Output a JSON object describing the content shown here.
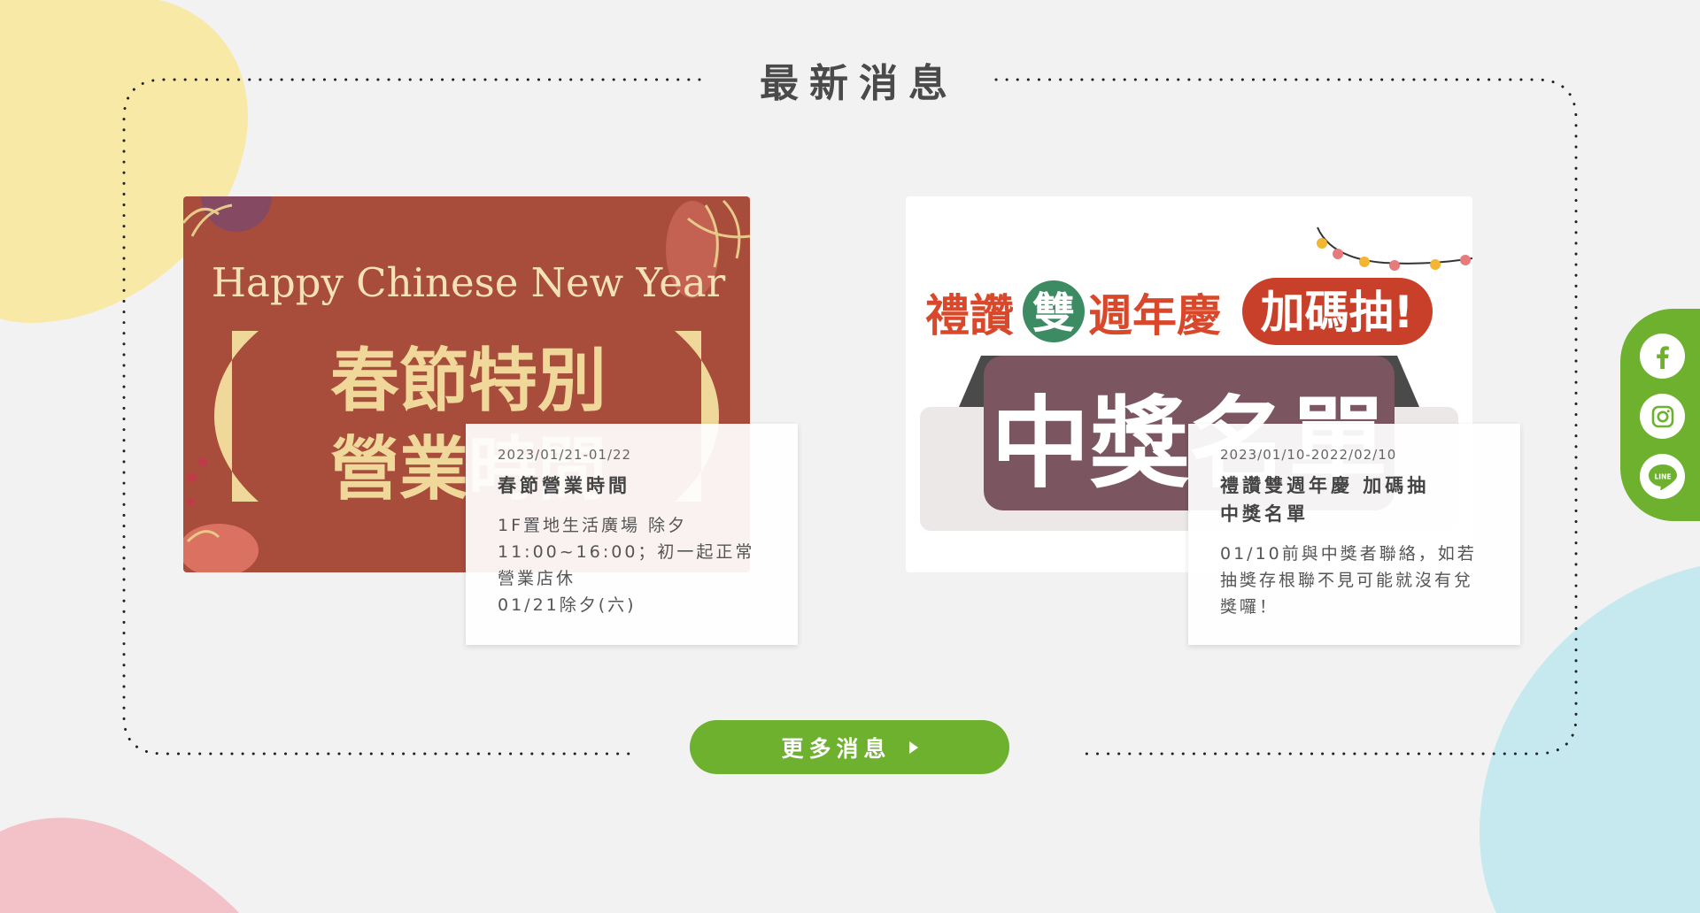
{
  "section": {
    "title": "最新消息"
  },
  "news": [
    {
      "date": "2023/01/21-01/22",
      "title": "春節營業時間",
      "description": "1F置地生活廣場 除夕\n11:00~16:00；初一起正常營業店休\n 01/21除夕(六)",
      "image": {
        "greeting": "Happy Chinese New Year",
        "headline_line1": "春節特別",
        "headline_line2": "營業時間",
        "bg_color": "#a84c3c",
        "accent_color": "#f0d79a"
      }
    },
    {
      "date": "2023/01/10-2022/02/10",
      "title": "禮讚雙週年慶 加碼抽\n中獎名單",
      "description": "01/10前與中獎者聯絡，如若抽獎存根聯不見可能就沒有兌獎囉！",
      "image": {
        "headline_part1": "禮讚",
        "headline_badge": "雙",
        "headline_part2": "週年慶",
        "headline_bubble": "加碼抽!",
        "banner_text": "中獎名單",
        "bg_color": "#ffffff",
        "title_color": "#d9482a",
        "banner_color": "#7b5660"
      }
    }
  ],
  "more_button": {
    "label": "更多消息"
  },
  "social": [
    {
      "name": "facebook-icon",
      "color": "#6db12f"
    },
    {
      "name": "instagram-icon",
      "color": "#6db12f"
    },
    {
      "name": "line-icon",
      "color": "#6db12f"
    }
  ],
  "colors": {
    "background": "#f2f2f2",
    "brand_green": "#6db12f",
    "blob_yellow": "#f8e9a6",
    "blob_pink": "#f3c2c8",
    "blob_blue": "#c6e9f0"
  }
}
